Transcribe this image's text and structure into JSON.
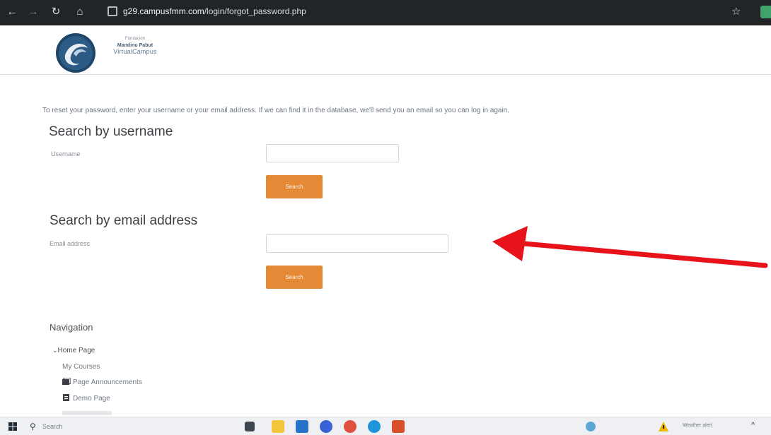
{
  "browser": {
    "back_glyph": "←",
    "forward_glyph": "→",
    "reload_glyph": "↻",
    "home_glyph": "⌂",
    "url_host": "g29.campusfmm.com",
    "url_path": "/login/forgot_password.php",
    "star_glyph": "☆"
  },
  "header": {
    "logo_line1": "Fundación",
    "logo_line2": "Mandinu Pabut",
    "logo_line3": "VirtualCampus"
  },
  "form": {
    "intro": "To reset your password, enter your username or your email address. If we can find it in the database, we'll send you an email so you can log in again.",
    "username_section": {
      "heading": "Search by username",
      "label": "Username",
      "value": "",
      "button": "Search"
    },
    "email_section": {
      "heading": "Search by email address",
      "label": "Email address",
      "value": "",
      "button": "Search"
    }
  },
  "annotation": {
    "color": "#e8121b"
  },
  "navigation": {
    "heading": "Navigation",
    "home": "Home Page",
    "items": [
      {
        "label": "My Courses",
        "icon": "none"
      },
      {
        "label": "Page Announcements",
        "icon": "folders-icon"
      },
      {
        "label": "Demo Page",
        "icon": "page-icon"
      }
    ]
  },
  "taskbar": {
    "search_placeholder": "Search",
    "weather_text": "Weather alert",
    "chevron": "^"
  },
  "colors": {
    "accent_button": "#e48a36",
    "browser_bar": "#222528",
    "annotation_red": "#e8121b"
  }
}
